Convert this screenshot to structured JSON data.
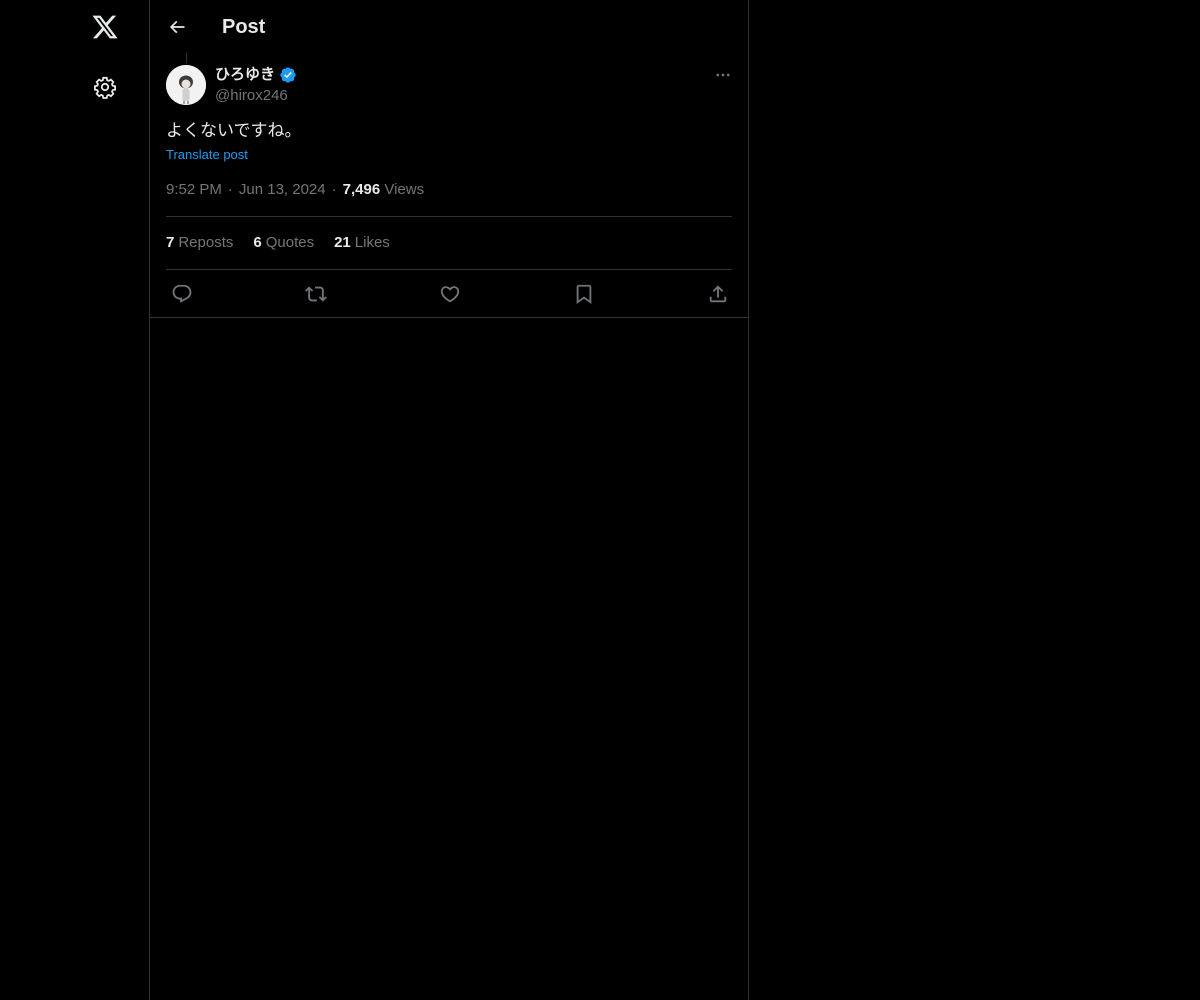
{
  "header": {
    "title": "Post"
  },
  "nav": {
    "logo_icon": "x-logo-icon",
    "settings_icon": "gear-icon"
  },
  "post": {
    "author": {
      "display_name": "ひろゆき",
      "handle": "@hirox246",
      "verified": true
    },
    "text": "よくないですね。",
    "translate_label": "Translate post",
    "time": "9:52 PM",
    "date": "Jun 13, 2024",
    "views_count": "7,496",
    "views_label": "Views",
    "separator": "·"
  },
  "stats": {
    "reposts_count": "7",
    "reposts_label": "Reposts",
    "quotes_count": "6",
    "quotes_label": "Quotes",
    "likes_count": "21",
    "likes_label": "Likes"
  },
  "actions": [
    "reply-icon",
    "repost-icon",
    "like-icon",
    "bookmark-icon",
    "share-icon"
  ],
  "colors": {
    "background": "#000000",
    "text": "#e7e9ea",
    "muted": "#71767b",
    "link": "#1d9bf0",
    "border": "#2f3336",
    "verified": "#1d9bf0"
  }
}
